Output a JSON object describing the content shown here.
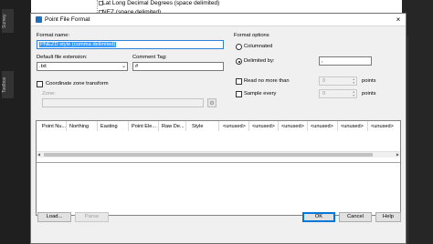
{
  "background": {
    "tree_items": [
      "Lat Long Decimal Degrees (space delimited)",
      "NEZ (space delimited)"
    ],
    "left_tabs": [
      "Survey",
      "Toolbox"
    ]
  },
  "dialog": {
    "title": "Point File Format",
    "close_glyph": "×"
  },
  "format_name": {
    "label": "Format name:",
    "value": "PNEZD style (comma delimited)"
  },
  "extension": {
    "label": "Default file extension:",
    "value": ".txt"
  },
  "comment_tag": {
    "label": "Comment Tag:",
    "value": "#"
  },
  "coordinate_zone": {
    "checkbox_label": "Coordinate zone transform",
    "zone_label": "Zone:"
  },
  "format_options": {
    "title": "Format options",
    "columnated_label": "Columnated",
    "delimited_label": "Delimited by:",
    "delimiter_value": ",",
    "read_no_more_label": "Read no more than",
    "read_no_more_value": "0",
    "read_units": "points",
    "sample_every_label": "Sample every",
    "sample_every_value": "0",
    "sample_units": "points"
  },
  "grid": {
    "columns": [
      "Point Nu...",
      "Northing",
      "Easting",
      "Point Ele...",
      "Raw De...",
      "Style",
      "<unused>",
      "<unused>",
      "<unused>",
      "<unused>",
      "<unused>",
      "<unused>"
    ]
  },
  "buttons": {
    "load": "Load...",
    "parse": "Parse",
    "ok": "OK",
    "cancel": "Cancel",
    "help": "Help"
  }
}
